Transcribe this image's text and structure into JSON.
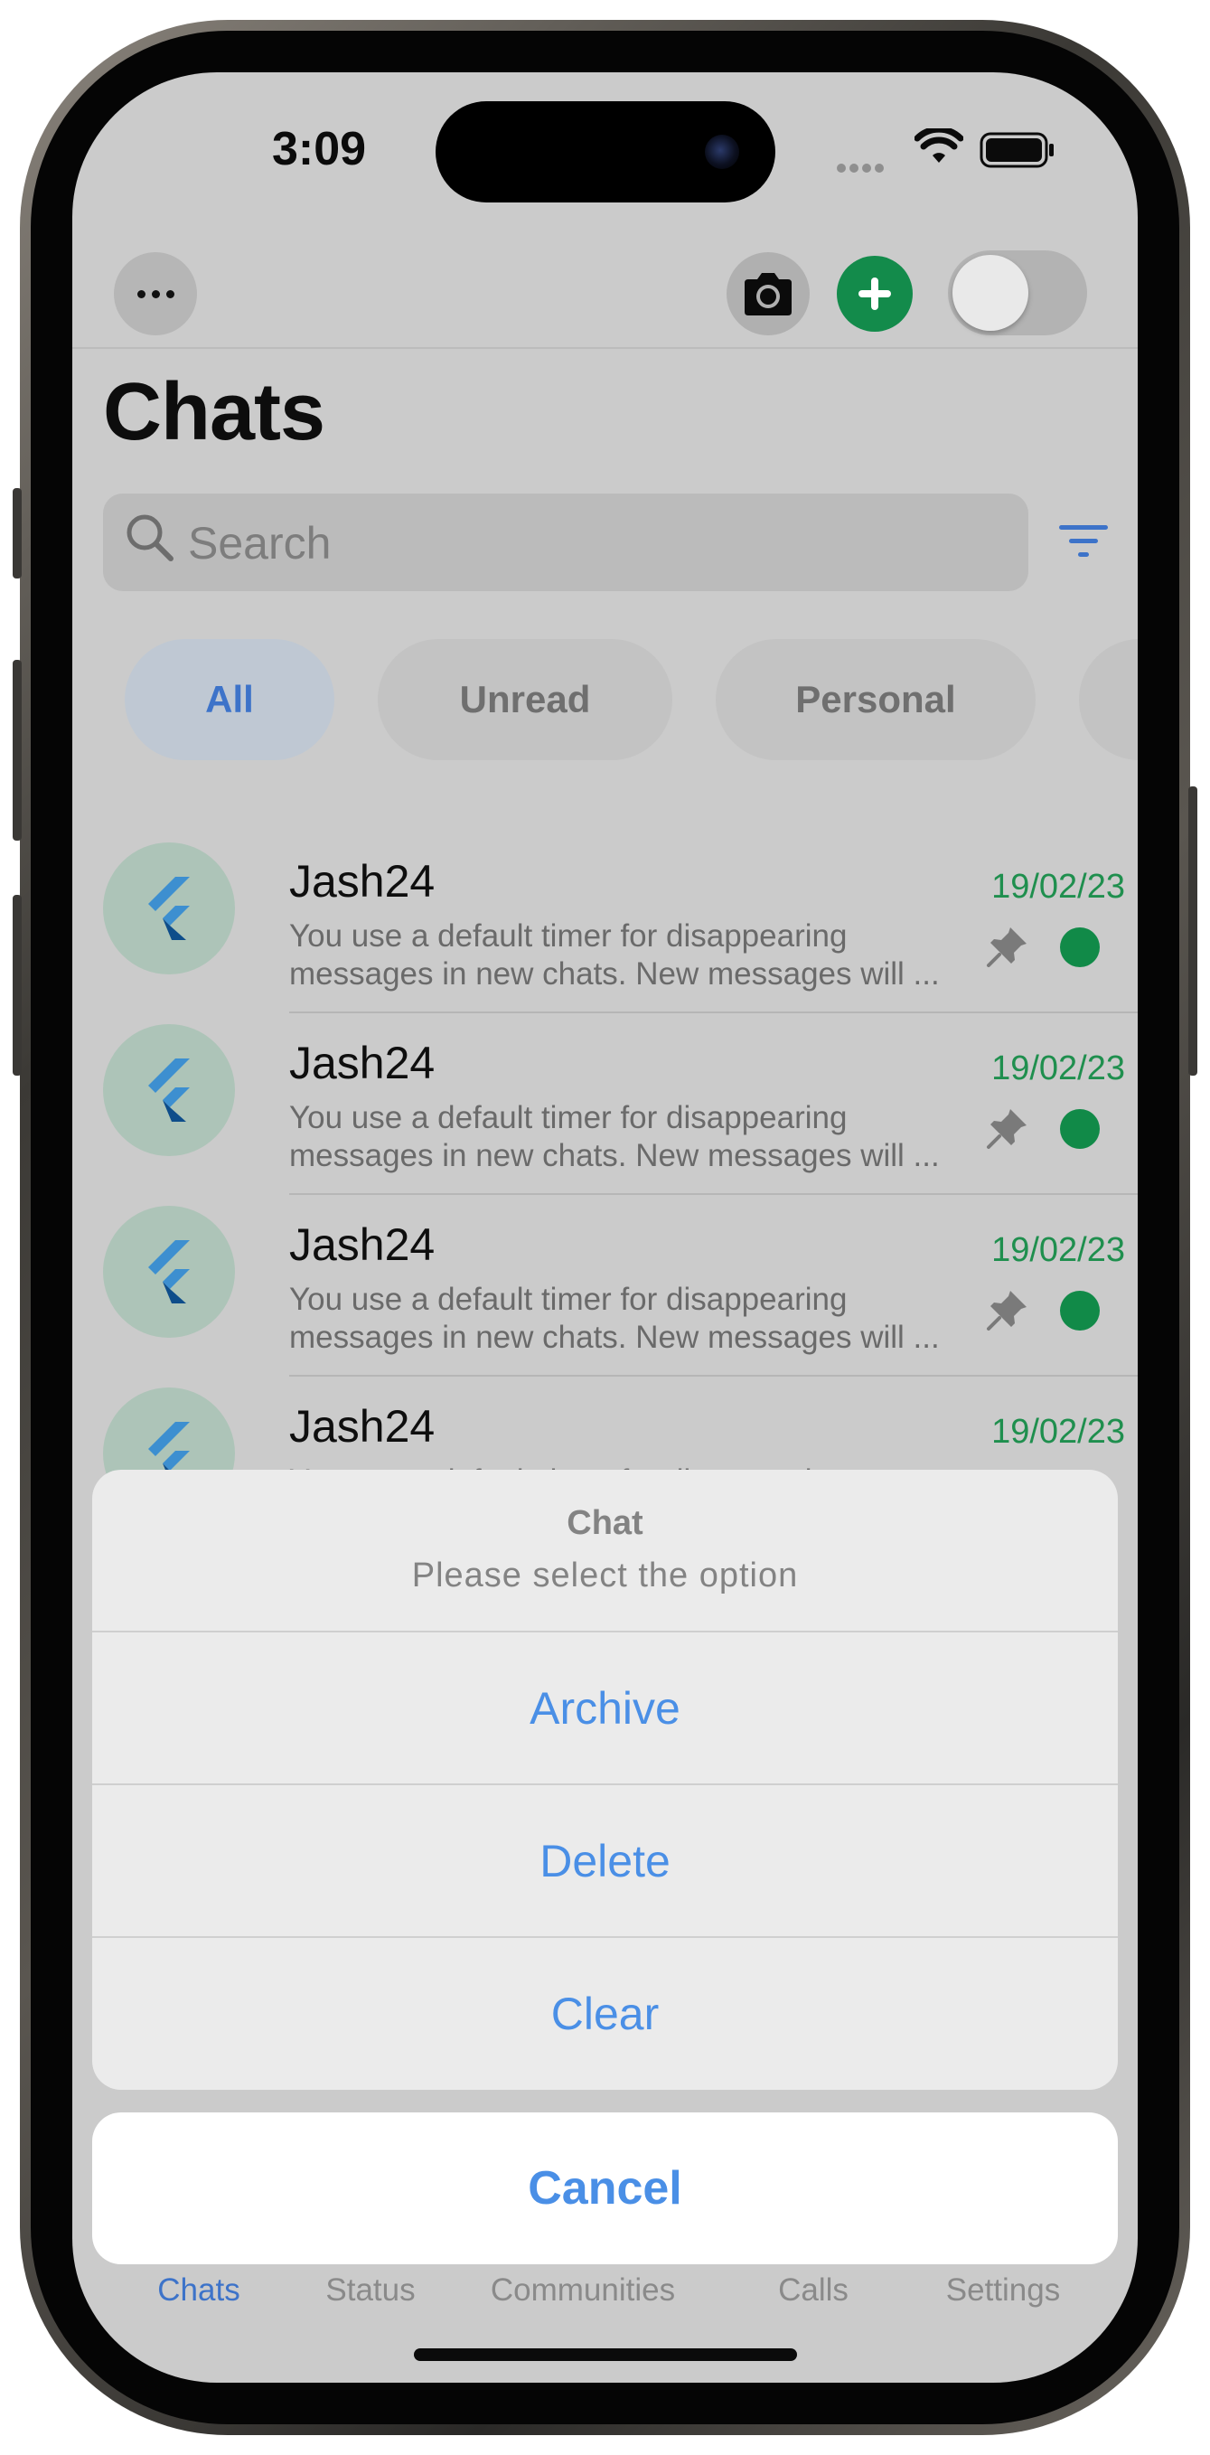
{
  "status_bar": {
    "time": "3:09"
  },
  "header": {
    "title": "Chats"
  },
  "search": {
    "placeholder": "Search"
  },
  "filters": [
    {
      "label": "All",
      "active": true
    },
    {
      "label": "Unread",
      "active": false
    },
    {
      "label": "Personal",
      "active": false
    }
  ],
  "chats": [
    {
      "name": "Jash24",
      "message_line1": "You use a default timer for disappearing",
      "message_line2": "messages in new chats. New messages will ...",
      "date": "19/02/23",
      "pinned": true,
      "unread": true
    },
    {
      "name": "Jash24",
      "message_line1": "You use a default timer for disappearing",
      "message_line2": "messages in new chats. New messages will ...",
      "date": "19/02/23",
      "pinned": true,
      "unread": true
    },
    {
      "name": "Jash24",
      "message_line1": "You use a default timer for disappearing",
      "message_line2": "messages in new chats. New messages will ...",
      "date": "19/02/23",
      "pinned": true,
      "unread": true
    },
    {
      "name": "Jash24",
      "message_line1": "You use a default timer for disappearing",
      "message_line2": "",
      "date": "19/02/23",
      "pinned": true,
      "unread": true
    }
  ],
  "action_sheet": {
    "title": "Chat",
    "subtitle": "Please select the option",
    "actions": [
      "Archive",
      "Delete",
      "Clear"
    ],
    "cancel": "Cancel"
  },
  "tabs": [
    {
      "label": "Chats",
      "active": true
    },
    {
      "label": "Status",
      "active": false
    },
    {
      "label": "Communities",
      "active": false
    },
    {
      "label": "Calls",
      "active": false
    },
    {
      "label": "Settings",
      "active": false
    }
  ],
  "colors": {
    "accent_blue": "#3d73c9",
    "action_blue": "#4a8fe6",
    "whatsapp_green": "#138b4b",
    "date_green": "#1f8f4e"
  },
  "icons": [
    "more-icon",
    "camera-icon",
    "plus-icon",
    "search-icon",
    "filter-icon",
    "pin-icon",
    "flutter-logo-icon",
    "wifi-icon",
    "battery-icon"
  ]
}
